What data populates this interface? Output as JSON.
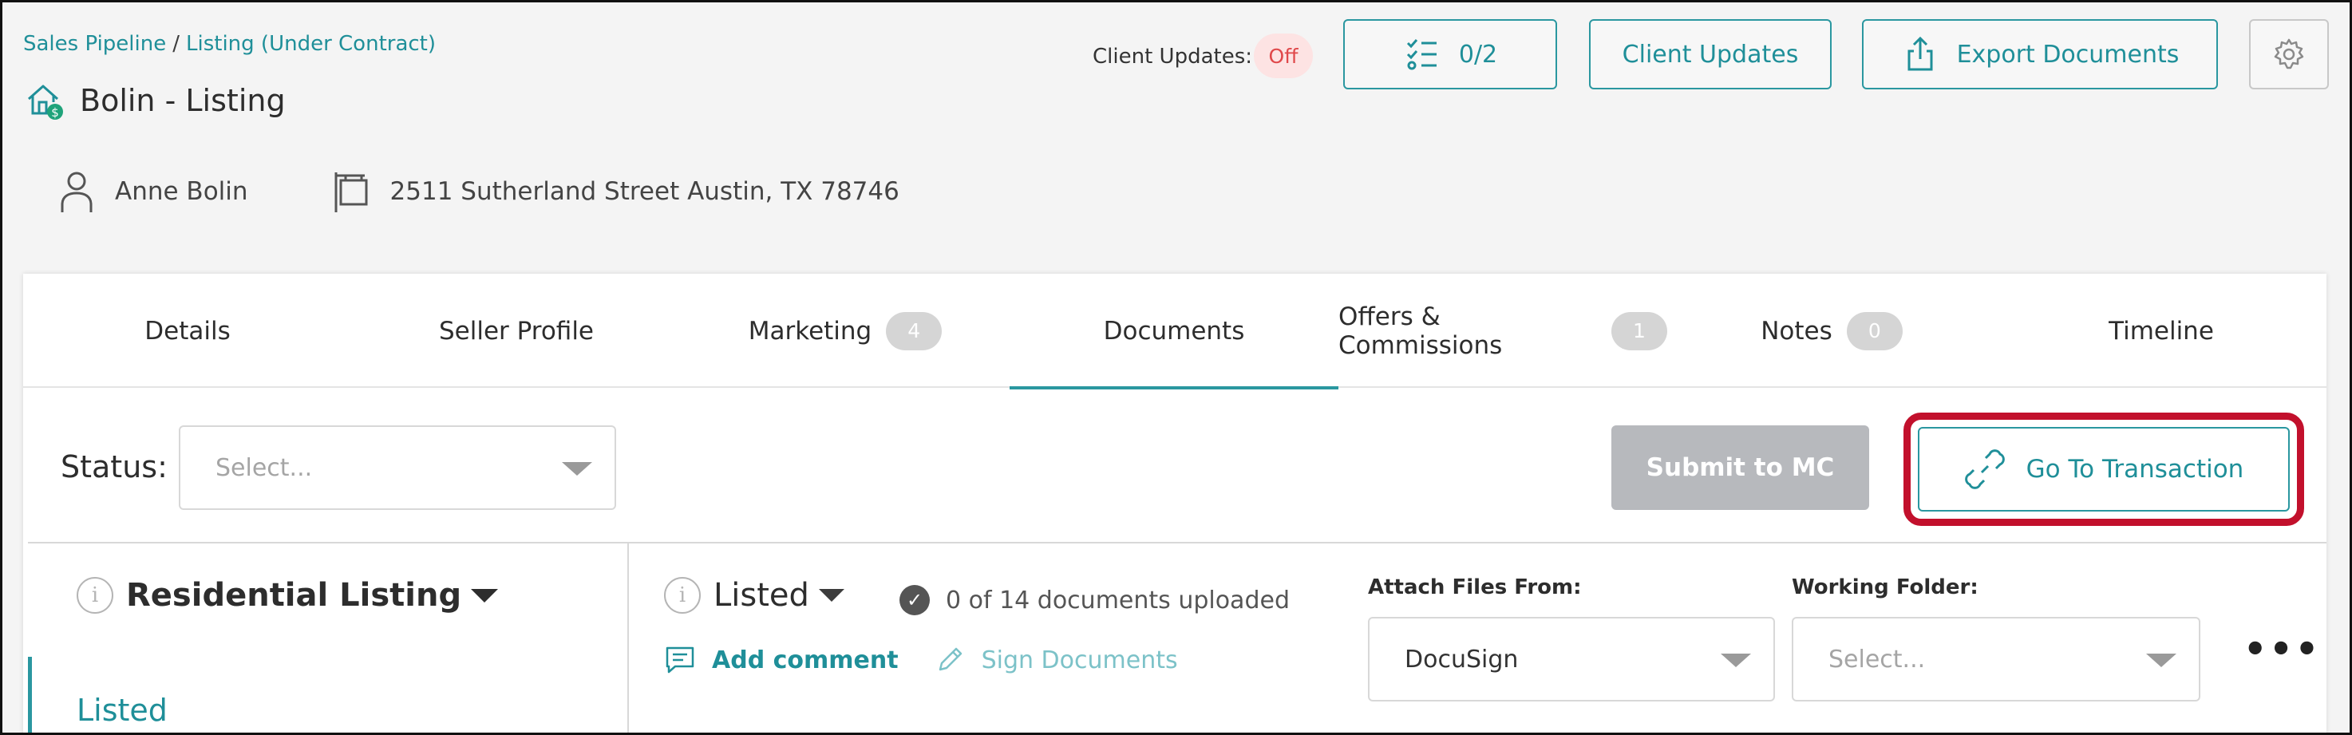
{
  "breadcrumb": {
    "pipeline": "Sales Pipeline",
    "separator": "/",
    "current": "Listing (Under Contract)"
  },
  "page_title": "Bolin - Listing",
  "client_updates": {
    "label": "Client Updates:",
    "state": "Off"
  },
  "header_buttons": {
    "tasks": "0/2",
    "client_updates": "Client Updates",
    "export": "Export Documents"
  },
  "contact": {
    "name": "Anne Bolin",
    "address": "2511 Sutherland Street Austin, TX 78746"
  },
  "tabs": [
    {
      "label": "Details"
    },
    {
      "label": "Seller Profile"
    },
    {
      "label": "Marketing",
      "badge": "4"
    },
    {
      "label": "Documents"
    },
    {
      "label": "Offers & Commissions",
      "badge": "1"
    },
    {
      "label": "Notes",
      "badge": "0"
    },
    {
      "label": "Timeline"
    }
  ],
  "active_tab": "Documents",
  "status": {
    "label": "Status:",
    "placeholder": "Select..."
  },
  "submit_button": "Submit to MC",
  "goto_button": "Go To Transaction",
  "left_panel": {
    "heading": "Residential Listing",
    "active_item": "Listed"
  },
  "stage": {
    "title": "Listed",
    "doc_status": "0 of 14 documents uploaded"
  },
  "actions": {
    "add_comment": "Add comment",
    "sign_documents": "Sign Documents"
  },
  "attach_files": {
    "label": "Attach Files From:",
    "value": "DocuSign"
  },
  "working_folder": {
    "label": "Working Folder:",
    "placeholder": "Select..."
  },
  "more_menu": "•••",
  "colors": {
    "accent": "#1f8f99",
    "highlight": "#c2102c",
    "off_badge": "#e0484a"
  }
}
